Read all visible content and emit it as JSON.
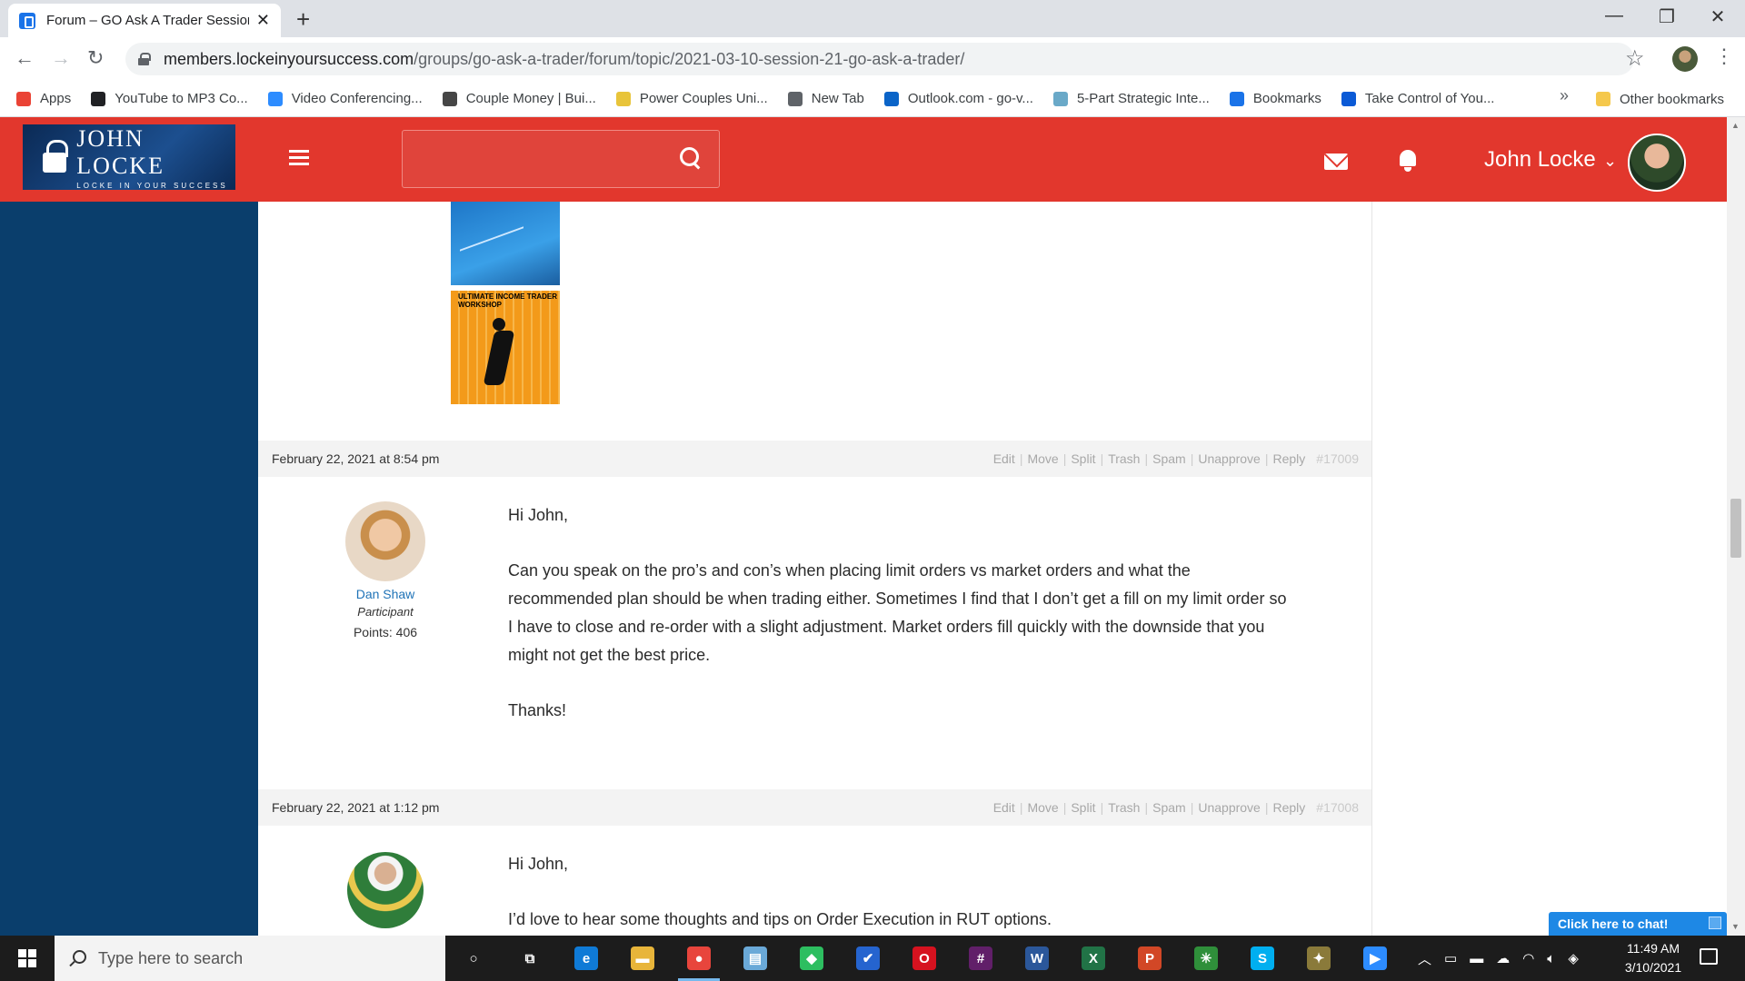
{
  "browser": {
    "tab_title": "Forum – GO Ask A Trader Session",
    "url_host": "members.lockeinyoursuccess.com",
    "url_path": "/groups/go-ask-a-trader/forum/topic/2021-03-10-session-21-go-ask-a-trader/",
    "bookmarks": [
      {
        "label": "Apps",
        "icon": "apps-grid-icon",
        "color": "#ea4335"
      },
      {
        "label": "YouTube to MP3 Co...",
        "icon": "music-note-icon",
        "color": "#202124"
      },
      {
        "label": "Video Conferencing...",
        "icon": "zoom-icon",
        "color": "#2d8cff"
      },
      {
        "label": "Couple Money | Bui...",
        "icon": "wordpress-icon",
        "color": "#464646"
      },
      {
        "label": "Power Couples Uni...",
        "icon": "kajabi-icon",
        "color": "#e8c43a"
      },
      {
        "label": "New Tab",
        "icon": "globe-icon",
        "color": "#5f6368"
      },
      {
        "label": "Outlook.com - go-v...",
        "icon": "outlook-icon",
        "color": "#0a64c8"
      },
      {
        "label": "5-Part Strategic Inte...",
        "icon": "circle-logo-icon",
        "color": "#6aa9c8"
      },
      {
        "label": "Bookmarks",
        "icon": "star-icon",
        "color": "#1a73e8"
      },
      {
        "label": "Take Control of You...",
        "icon": "edge-icon",
        "color": "#0b5ad6"
      }
    ],
    "other_bookmarks": "Other bookmarks"
  },
  "header": {
    "logo_name": "JOHN LOCKE",
    "logo_tagline": "LOCKE IN YOUR SUCCESS",
    "user_name": "John Locke"
  },
  "admin_links": [
    "Edit",
    "Move",
    "Split",
    "Trash",
    "Spam",
    "Unapprove",
    "Reply"
  ],
  "posts": [
    {
      "date": "February 22, 2021 at 8:54 pm",
      "id": "#17009",
      "author": {
        "name": "Dan Shaw",
        "role": "Participant",
        "points": "Points: 406"
      },
      "paragraphs": [
        "Hi John,",
        "Can you speak on the pro’s and con’s when placing limit orders vs market orders and what the recommended plan should be when trading either. Sometimes I find that I don’t get a fill on my limit order so I have to close and re-order with a slight adjustment. Market orders fill quickly with the downside that you might not get the best price.",
        "Thanks!"
      ]
    },
    {
      "date": "February 22, 2021 at 1:12 pm",
      "id": "#17008",
      "paragraphs": [
        "Hi John,",
        "I’d love to hear some thoughts and tips on Order Execution in RUT options."
      ]
    }
  ],
  "signature_banner_text": "ULTIMATE INCOME TRADER WORKSHOP",
  "chat_button": "Click here to chat!",
  "taskbar": {
    "search_placeholder": "Type here to search",
    "time": "11:49 AM",
    "date": "3/10/2021",
    "apps": [
      {
        "name": "cortana-icon",
        "glyph": "○",
        "color": "transparent"
      },
      {
        "name": "task-view-icon",
        "glyph": "⧉",
        "color": "transparent"
      },
      {
        "name": "edge-icon",
        "glyph": "e",
        "color": "#0f7ad6"
      },
      {
        "name": "file-explorer-icon",
        "glyph": "▬",
        "color": "#e8b53a"
      },
      {
        "name": "chrome-icon",
        "glyph": "●",
        "color": "#e8453c"
      },
      {
        "name": "notepad-icon",
        "glyph": "▤",
        "color": "#6aa9d8"
      },
      {
        "name": "evernote-icon",
        "glyph": "◆",
        "color": "#2dbe60"
      },
      {
        "name": "todo-icon",
        "glyph": "✔",
        "color": "#2564cf"
      },
      {
        "name": "opera-icon",
        "glyph": "O",
        "color": "#d6121f"
      },
      {
        "name": "slack-icon",
        "glyph": "#",
        "color": "#611f69"
      },
      {
        "name": "word-icon",
        "glyph": "W",
        "color": "#2b579a"
      },
      {
        "name": "excel-icon",
        "glyph": "X",
        "color": "#217346"
      },
      {
        "name": "powerpoint-icon",
        "glyph": "P",
        "color": "#d24726"
      },
      {
        "name": "app-star-icon",
        "glyph": "✳",
        "color": "#2f8f3a"
      },
      {
        "name": "skype-icon",
        "glyph": "S",
        "color": "#00aff0"
      },
      {
        "name": "app-bird-icon",
        "glyph": "✦",
        "color": "#8a7a3a"
      },
      {
        "name": "zoom-icon",
        "glyph": "▶",
        "color": "#2d8cff"
      }
    ]
  }
}
